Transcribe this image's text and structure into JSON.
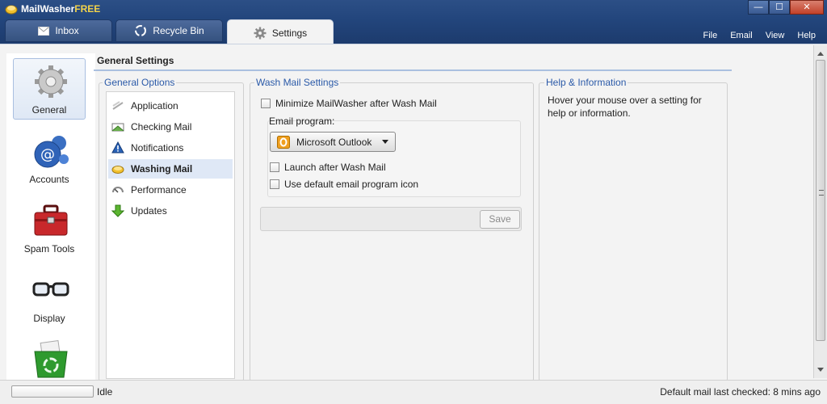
{
  "app": {
    "title_main": "MailWasher",
    "title_free": "FREE"
  },
  "window_controls": {
    "minimize": "—",
    "maximize": "☐",
    "close": "✕"
  },
  "tabs": [
    {
      "label": "Inbox",
      "icon": "envelope-icon"
    },
    {
      "label": "Recycle Bin",
      "icon": "recycle-icon"
    },
    {
      "label": "Settings",
      "icon": "gear-icon",
      "active": true
    }
  ],
  "menu": [
    "File",
    "Email",
    "View",
    "Help"
  ],
  "categories": [
    {
      "label": "General",
      "icon": "gears-icon",
      "active": true
    },
    {
      "label": "Accounts",
      "icon": "email-globe-icon"
    },
    {
      "label": "Spam Tools",
      "icon": "toolbox-icon"
    },
    {
      "label": "Display",
      "icon": "glasses-icon"
    },
    {
      "label": "",
      "icon": "recycle-bin-icon"
    }
  ],
  "page_title": "General Settings",
  "general_options": {
    "legend": "General Options",
    "items": [
      {
        "label": "Application",
        "icon": "application-icon"
      },
      {
        "label": "Checking Mail",
        "icon": "checking-mail-icon"
      },
      {
        "label": "Notifications",
        "icon": "warning-icon"
      },
      {
        "label": "Washing Mail",
        "icon": "washing-mail-icon",
        "active": true
      },
      {
        "label": "Performance",
        "icon": "performance-icon"
      },
      {
        "label": "Updates",
        "icon": "down-arrow-icon"
      }
    ]
  },
  "wash_mail": {
    "legend": "Wash Mail Settings",
    "minimize_label": "Minimize MailWasher after Wash Mail",
    "minimize_checked": false,
    "email_program_label": "Email program:",
    "email_program_value": "Microsoft Outlook",
    "launch_label": "Launch after Wash Mail",
    "launch_checked": false,
    "default_icon_label": "Use default email program icon",
    "default_icon_checked": false,
    "save_label": "Save"
  },
  "help": {
    "legend": "Help & Information",
    "text": "Hover your mouse over a setting for help or information."
  },
  "status": {
    "left": "Idle",
    "right": "Default mail last checked: 8 mins ago"
  },
  "colors": {
    "titlebar": "#23467d",
    "legend": "#2b5aa8",
    "accent_free": "#f3d34a"
  }
}
